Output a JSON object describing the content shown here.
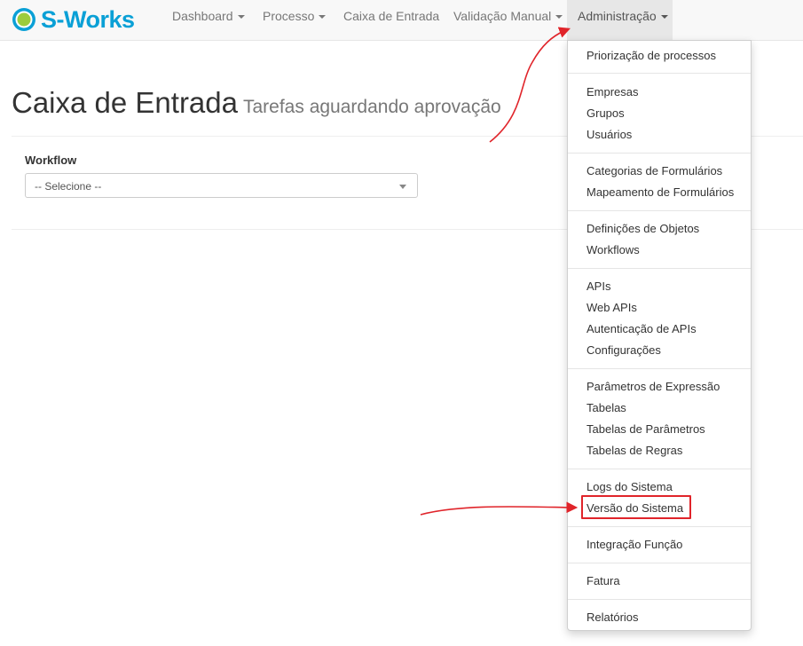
{
  "brand": {
    "text": "S-Works"
  },
  "nav": {
    "items": [
      {
        "label": "Dashboard",
        "dropdown": true
      },
      {
        "label": "Processo",
        "dropdown": true
      },
      {
        "label": "Caixa de Entrada",
        "dropdown": false
      },
      {
        "label": "Validação Manual",
        "dropdown": true
      },
      {
        "label": "Administração",
        "dropdown": true,
        "active": true
      }
    ]
  },
  "page": {
    "title": "Caixa de Entrada",
    "subtitle": "Tarefas aguardando aprovação"
  },
  "workflow": {
    "label": "Workflow",
    "selected": "-- Selecione --"
  },
  "admin_menu": {
    "groups": [
      [
        "Priorização de processos"
      ],
      [
        "Empresas",
        "Grupos",
        "Usuários"
      ],
      [
        "Categorias de Formulários",
        "Mapeamento de Formulários"
      ],
      [
        "Definições de Objetos",
        "Workflows"
      ],
      [
        "APIs",
        "Web APIs",
        "Autenticação de APIs",
        "Configurações"
      ],
      [
        "Parâmetros de Expressão",
        "Tabelas",
        "Tabelas de Parâmetros",
        "Tabelas de Regras"
      ],
      [
        "Logs do Sistema",
        "Versão do Sistema"
      ],
      [
        "Integração Função"
      ],
      [
        "Fatura"
      ],
      [
        "Relatórios"
      ]
    ],
    "highlighted": "Versão do Sistema"
  },
  "colors": {
    "brand": "#0aa0d6",
    "annotation": "#e0242a",
    "navbar_bg": "#f8f8f8",
    "active_nav_bg": "#e7e7e7"
  }
}
